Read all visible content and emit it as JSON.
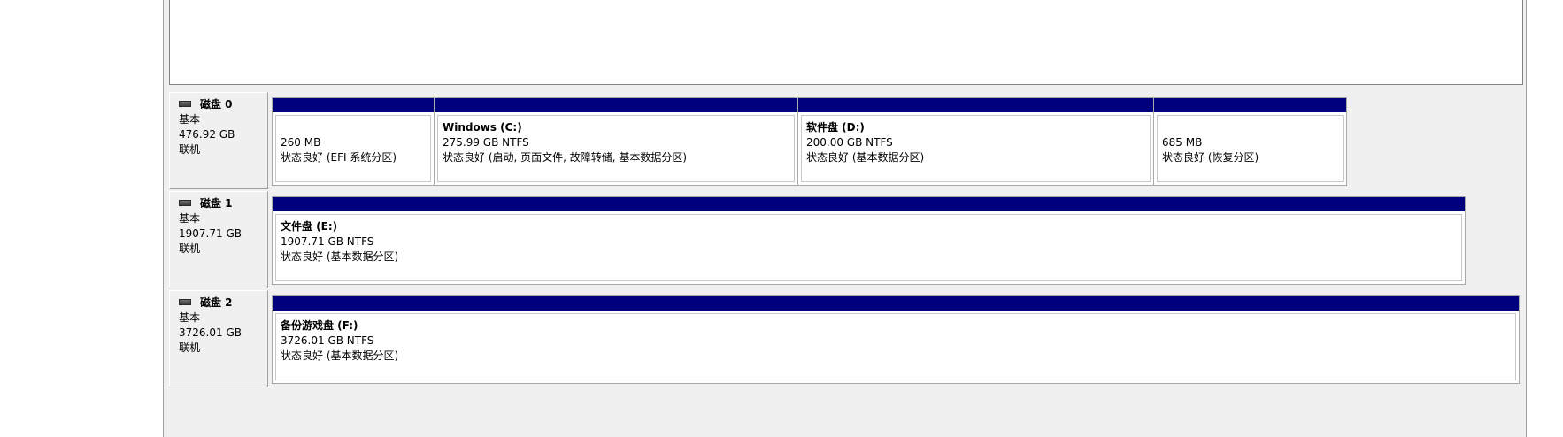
{
  "disks": [
    {
      "name": "磁盘 0",
      "type": "基本",
      "size": "476.92 GB",
      "status": "联机",
      "partitions": [
        {
          "name": "",
          "size_fs": "260 MB",
          "status": "状态良好 (EFI 系统分区)"
        },
        {
          "name": "Windows (C:)",
          "size_fs": "275.99 GB NTFS",
          "status": "状态良好 (启动, 页面文件, 故障转储, 基本数据分区)"
        },
        {
          "name": "软件盘 (D:)",
          "size_fs": "200.00 GB NTFS",
          "status": "状态良好 (基本数据分区)"
        },
        {
          "name": "",
          "size_fs": "685 MB",
          "status": "状态良好 (恢复分区)"
        }
      ]
    },
    {
      "name": "磁盘 1",
      "type": "基本",
      "size": "1907.71 GB",
      "status": "联机",
      "partitions": [
        {
          "name": "文件盘 (E:)",
          "size_fs": "1907.71 GB NTFS",
          "status": "状态良好 (基本数据分区)"
        }
      ]
    },
    {
      "name": "磁盘 2",
      "type": "基本",
      "size": "3726.01 GB",
      "status": "联机",
      "partitions": [
        {
          "name": "备份游戏盘 (F:)",
          "size_fs": "3726.01 GB NTFS",
          "status": "状态良好 (基本数据分区)"
        }
      ]
    }
  ],
  "colors": {
    "partition_bar": "#00007f",
    "pane_background": "#f0f0f0"
  },
  "icons": {
    "disk": "disk-drive-icon"
  }
}
